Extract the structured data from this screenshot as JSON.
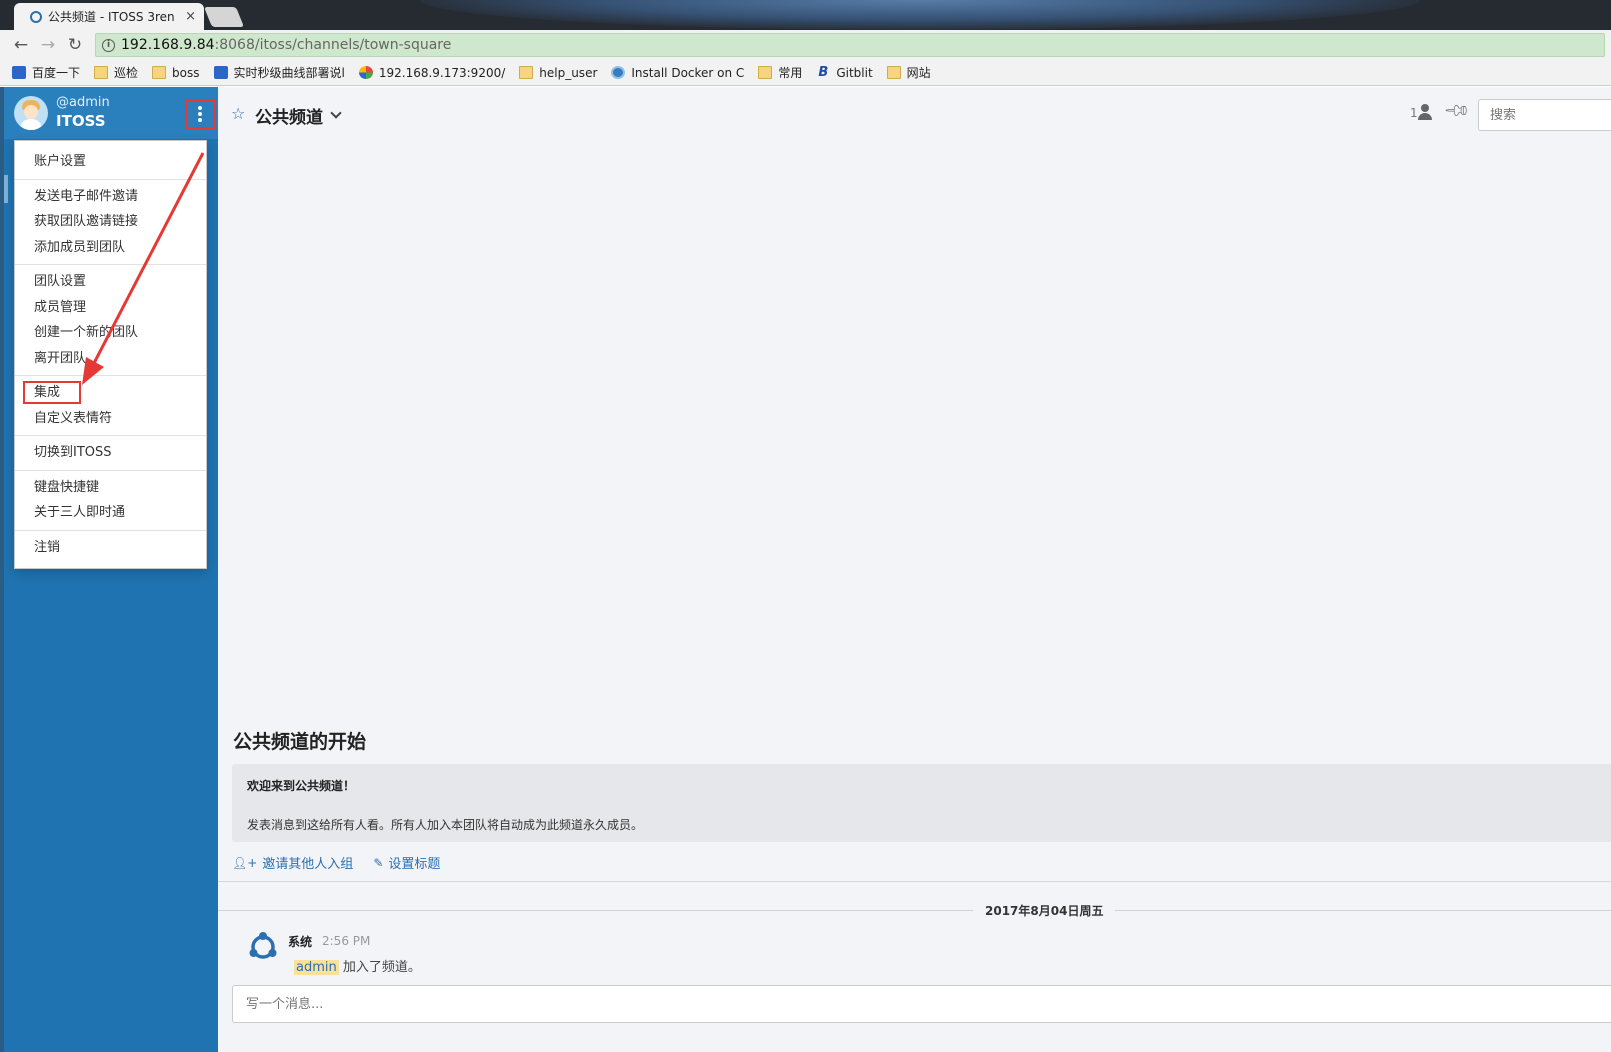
{
  "browser": {
    "tab_title": "公共频道 - ITOSS 3ren",
    "tab_close": "×",
    "back": "←",
    "forward": "→",
    "reload": "↻",
    "url_host": "192.168.9.84",
    "url_path": ":8068/itoss/channels/town-square",
    "bookmarks": [
      {
        "label": "百度一下",
        "icon": "paw-icon"
      },
      {
        "label": "巡检",
        "icon": "folder-icon"
      },
      {
        "label": "boss",
        "icon": "folder-icon"
      },
      {
        "label": "实时秒级曲线部署说l",
        "icon": "chart-icon"
      },
      {
        "label": "192.168.9.173:9200/",
        "icon": "app-icon"
      },
      {
        "label": "help_user",
        "icon": "folder-icon"
      },
      {
        "label": "Install Docker on C",
        "icon": "docker-icon"
      },
      {
        "label": "常用",
        "icon": "folder-icon"
      },
      {
        "label": "Gitblit",
        "icon": "gitblit-icon"
      },
      {
        "label": "网站",
        "icon": "folder-icon"
      }
    ]
  },
  "sidebar": {
    "username": "@admin",
    "team_name": "ITOSS",
    "menu_groups": [
      [
        "账户设置"
      ],
      [
        "发送电子邮件邀请",
        "获取团队邀请链接",
        "添加成员到团队"
      ],
      [
        "团队设置",
        "成员管理",
        "创建一个新的团队",
        "离开团队"
      ],
      [
        "集成",
        "自定义表情符"
      ],
      [
        "切换到ITOSS"
      ],
      [
        "键盘快捷键",
        "关于三人即时通"
      ],
      [
        "注销"
      ]
    ]
  },
  "channel": {
    "star": "☆",
    "title": "公共频道",
    "member_count": "1",
    "search_placeholder": "搜索",
    "intro_title": "公共频道的开始",
    "intro_welcome": "欢迎来到公共频道！",
    "intro_desc": "发表消息到这给所有人看。所有人加入本团队将自动成为此频道永久成员。",
    "invite_link": "邀请其他人入组",
    "set_header_link": "设置标题",
    "date_separator": "2017年8月04日周五",
    "post": {
      "author": "系统",
      "time": "2:56 PM",
      "mention": "admin",
      "text": " 加入了频道。"
    },
    "message_placeholder": "写一个消息..."
  },
  "colors": {
    "sidebar": "#1f73b0",
    "sidebar_header": "#2a7fbd",
    "main_bg": "#f2f4f8",
    "link": "#2c6fb0",
    "annotation_red": "#e53935"
  }
}
